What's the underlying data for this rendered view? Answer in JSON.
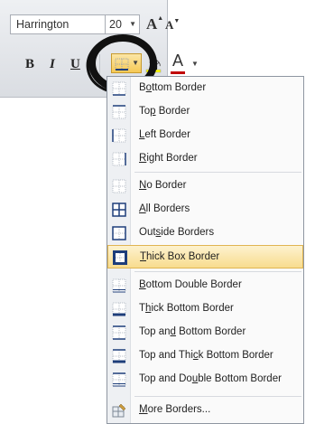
{
  "ribbon": {
    "font_name": "Harrington",
    "font_size": "20",
    "grow_label": "A",
    "shrink_label": "A",
    "bold_label": "B",
    "italic_label": "I",
    "underline_label": "U",
    "font_color_label": "A"
  },
  "menu": {
    "items": [
      {
        "pre": "B",
        "key": "o",
        "post": "ttom Border",
        "icon": "bottom-border-icon"
      },
      {
        "pre": "To",
        "key": "p",
        "post": " Border",
        "icon": "top-border-icon"
      },
      {
        "pre": "",
        "key": "L",
        "post": "eft Border",
        "icon": "left-border-icon"
      },
      {
        "pre": "",
        "key": "R",
        "post": "ight Border",
        "icon": "right-border-icon"
      },
      {
        "pre": "",
        "key": "N",
        "post": "o Border",
        "icon": "no-border-icon"
      },
      {
        "pre": "",
        "key": "A",
        "post": "ll Borders",
        "icon": "all-borders-icon"
      },
      {
        "pre": "Out",
        "key": "s",
        "post": "ide Borders",
        "icon": "outside-borders-icon"
      },
      {
        "pre": "",
        "key": "T",
        "post": "hick Box Border",
        "icon": "thick-box-border-icon"
      },
      {
        "pre": "",
        "key": "B",
        "post": "ottom Double Border",
        "icon": "bottom-double-border-icon"
      },
      {
        "pre": "T",
        "key": "h",
        "post": "ick Bottom Border",
        "icon": "thick-bottom-border-icon"
      },
      {
        "pre": "Top an",
        "key": "d",
        "post": " Bottom Border",
        "icon": "top-and-bottom-border-icon"
      },
      {
        "pre": "Top and Thi",
        "key": "c",
        "post": "k Bottom Border",
        "icon": "top-and-thick-bottom-border-icon"
      },
      {
        "pre": "Top and Do",
        "key": "u",
        "post": "ble Bottom Border",
        "icon": "top-and-double-bottom-border-icon"
      },
      {
        "pre": "",
        "key": "M",
        "post": "ore Borders...",
        "icon": "more-borders-icon"
      }
    ],
    "highlighted_index": 7
  },
  "colors": {
    "highlight": "#f8dc8e",
    "font_color_bar": "#c00000"
  }
}
